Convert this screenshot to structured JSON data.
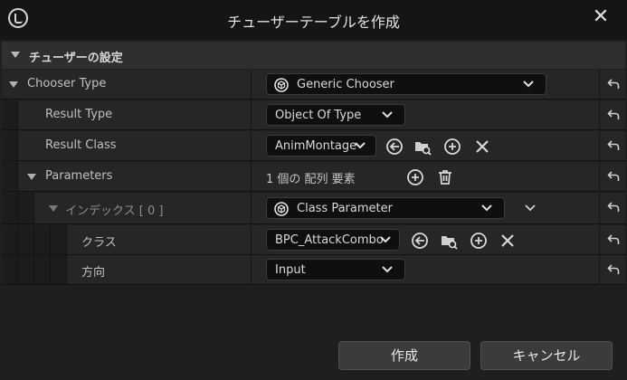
{
  "window": {
    "title": "チューザーテーブルを作成",
    "close_label": "✕"
  },
  "category": {
    "label": "チューザーの設定"
  },
  "rows": {
    "chooser_type": {
      "label": "Chooser Type",
      "value": "Generic Chooser"
    },
    "result_type": {
      "label": "Result Type",
      "value": "Object Of Type"
    },
    "result_class": {
      "label": "Result Class",
      "value": "AnimMontage"
    },
    "parameters": {
      "label": "Parameters",
      "count": "1 個の 配列 要素"
    },
    "index": {
      "label": "インデックス [ 0 ]",
      "value": "Class Parameter"
    },
    "class": {
      "label": "クラス",
      "value": "BPC_AttackCombo"
    },
    "direction": {
      "label": "方向",
      "value": "Input"
    }
  },
  "buttons": {
    "create": "作成",
    "cancel": "キャンセル"
  },
  "icons": {
    "logo": "unreal-logo-icon",
    "reset": "reset-arrow-icon",
    "browse": "use-selected-arrow-icon",
    "find": "browse-folder-icon",
    "add": "plus-circle-icon",
    "clear": "x-icon",
    "delete": "trash-icon"
  },
  "colors": {
    "background": "#1f1f1f",
    "row": "#262626",
    "field": "#0f0f0f",
    "button": "#3b3b3b"
  }
}
